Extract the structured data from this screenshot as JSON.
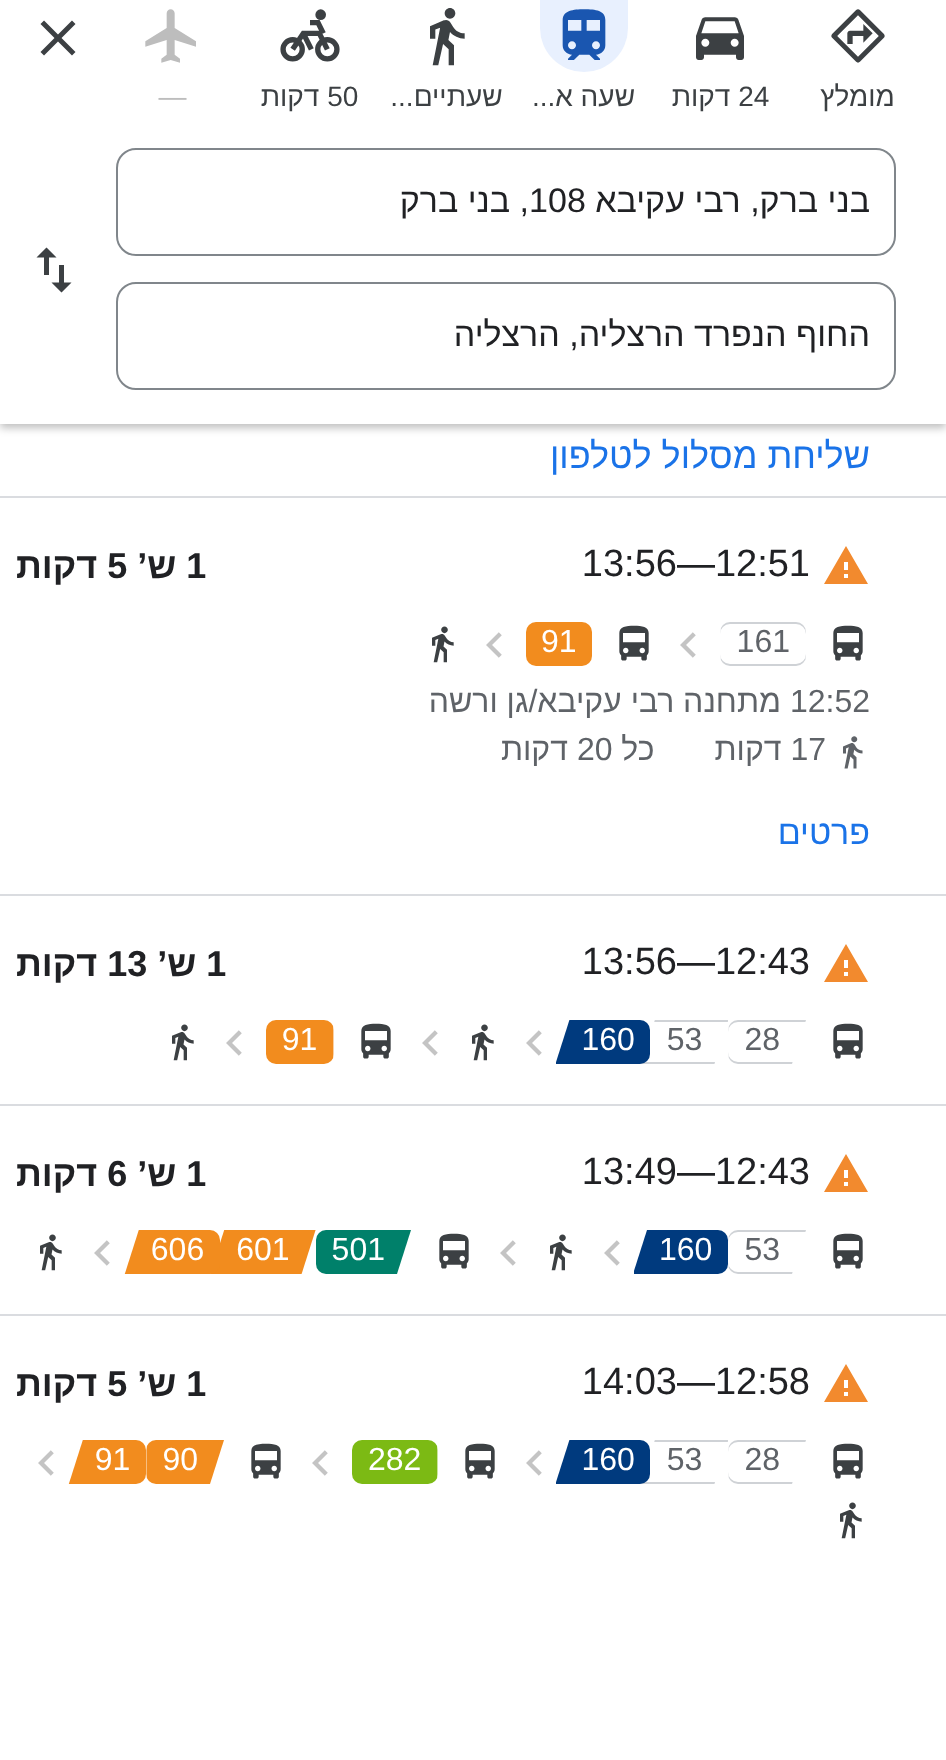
{
  "modes": [
    {
      "kind": "recommended",
      "label": "מומלץ",
      "selected": false,
      "disabled": false
    },
    {
      "kind": "car",
      "label": "24 דקות",
      "selected": false,
      "disabled": false
    },
    {
      "kind": "transit",
      "label": "שעה א...",
      "selected": true,
      "disabled": false
    },
    {
      "kind": "walk",
      "label": "שעתיים...",
      "selected": false,
      "disabled": false
    },
    {
      "kind": "bike",
      "label": "50 דקות",
      "selected": false,
      "disabled": false
    },
    {
      "kind": "flight",
      "label": "—",
      "selected": false,
      "disabled": true
    }
  ],
  "origin": {
    "value": "בני ברק, רבי עקיבא 108, בני ברק"
  },
  "destination": {
    "value": "החוף הנפרד הרצליה, הרצליה"
  },
  "send_link": "שליחת מסלול לטלפון",
  "routes": [
    {
      "warning": true,
      "times": "12:51—13:56",
      "duration": "1 ש’ 5 דקות",
      "steps": [
        {
          "kind": "bus",
          "lines": [
            {
              "number": "161",
              "color": "#ffffff"
            }
          ]
        },
        {
          "kind": "bus",
          "lines": [
            {
              "number": "91",
              "color": "#f28c1e"
            }
          ]
        },
        {
          "kind": "walk"
        }
      ],
      "departure": "12:52 מתחנה רבי עקיבא/גן ורשה",
      "walk_time": "17 דקות",
      "frequency": "כל 20 דקות",
      "details_link": "פרטים"
    },
    {
      "warning": true,
      "times": "12:43—13:56",
      "duration": "1 ש’ 13 דקות",
      "steps": [
        {
          "kind": "bus",
          "lines": [
            {
              "number": "28",
              "color": "#ffffff"
            },
            {
              "number": "53",
              "color": "#ffffff"
            },
            {
              "number": "160",
              "color": "#003a7e"
            }
          ]
        },
        {
          "kind": "walk"
        },
        {
          "kind": "bus",
          "lines": [
            {
              "number": "91",
              "color": "#f28c1e"
            }
          ]
        },
        {
          "kind": "walk"
        }
      ]
    },
    {
      "warning": true,
      "times": "12:43—13:49",
      "duration": "1 ש’ 6 דקות",
      "steps": [
        {
          "kind": "bus",
          "lines": [
            {
              "number": "53",
              "color": "#ffffff"
            },
            {
              "number": "160",
              "color": "#003a7e"
            }
          ]
        },
        {
          "kind": "walk"
        },
        {
          "kind": "bus",
          "lines": [
            {
              "number": "501",
              "color": "#00806a"
            },
            {
              "number": "601",
              "color": "#f28c1e"
            },
            {
              "number": "606",
              "color": "#f28c1e"
            }
          ]
        },
        {
          "kind": "walk"
        }
      ]
    },
    {
      "warning": true,
      "times": "12:58—14:03",
      "duration": "1 ש’ 5 דקות",
      "steps": [
        {
          "kind": "bus",
          "lines": [
            {
              "number": "28",
              "color": "#ffffff"
            },
            {
              "number": "53",
              "color": "#ffffff"
            },
            {
              "number": "160",
              "color": "#003a7e"
            }
          ]
        },
        {
          "kind": "bus",
          "lines": [
            {
              "number": "282",
              "color": "#7cba14"
            }
          ]
        },
        {
          "kind": "bus",
          "lines": [
            {
              "number": "90",
              "color": "#f28c1e"
            },
            {
              "number": "91",
              "color": "#f28c1e"
            }
          ]
        },
        {
          "kind": "walk"
        }
      ]
    }
  ]
}
